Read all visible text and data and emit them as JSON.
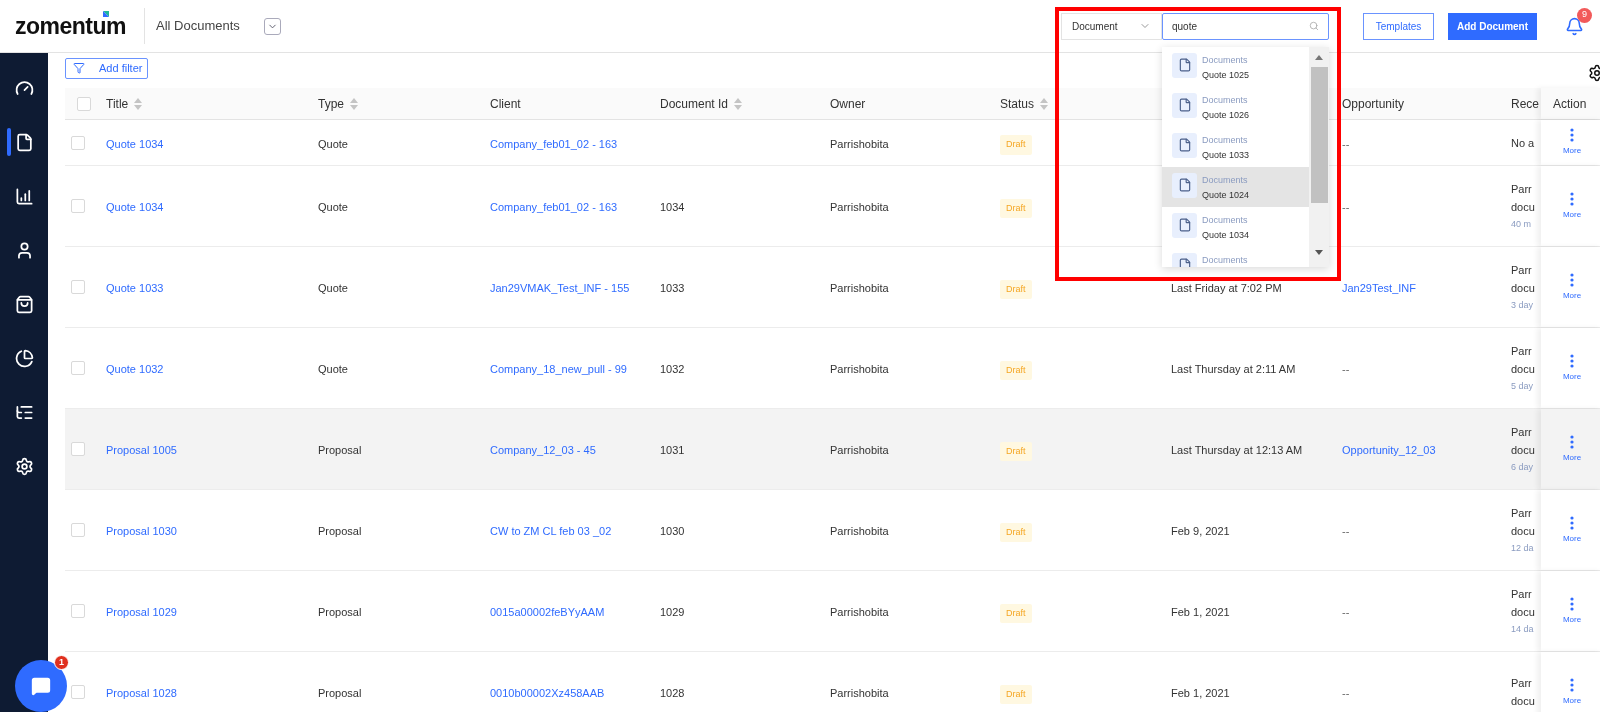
{
  "header": {
    "logo": "zomentum",
    "view": "All Documents",
    "search_scope": "Document",
    "search_value": "quote",
    "buttons": [
      "Templates",
      "Add Document"
    ],
    "notifications_badge": "9"
  },
  "sidebar": {
    "items": [
      {
        "kind": "dashboard",
        "selected": false
      },
      {
        "kind": "documents",
        "selected": true
      },
      {
        "kind": "reports",
        "selected": false
      },
      {
        "kind": "clients",
        "selected": false
      },
      {
        "kind": "products",
        "selected": false
      },
      {
        "kind": "analytics",
        "selected": false
      },
      {
        "kind": "workflows",
        "selected": false
      },
      {
        "kind": "settings",
        "selected": false
      }
    ]
  },
  "filter_button": "Add filter",
  "table": {
    "select_all_checked": false,
    "header": {
      "title": {
        "label": "Title",
        "sortable": true
      },
      "type": {
        "label": "Type",
        "sortable": true
      },
      "client": {
        "label": "Client",
        "sortable": false
      },
      "document_id": {
        "label": "Document Id",
        "sortable": true
      },
      "owner": {
        "label": "Owner",
        "sortable": false
      },
      "status": {
        "label": "Status",
        "sortable": true
      },
      "opportunity": {
        "label": "Opportunity",
        "sortable": false
      },
      "recent": {
        "label": "Rece"
      },
      "action": {
        "label": "Action"
      }
    },
    "rows": [
      {
        "checked": false,
        "highlighted": false,
        "title": "Quote 1034",
        "type": "Quote",
        "client": "Company_feb01_02 - 163",
        "owner": "Parrishobita",
        "status": "Draft",
        "opportunity": {
          "text": "--",
          "link": false
        },
        "recent": [
          "No a"
        ],
        "action": "More"
      },
      {
        "checked": false,
        "highlighted": false,
        "title": "Quote 1034",
        "type": "Quote",
        "client": "Company_feb01_02 - 163",
        "document_id": "1034",
        "owner": "Parrishobita",
        "status": "Draft",
        "opportunity": {
          "text": "--",
          "link": false
        },
        "recent": [
          "Parr",
          "docu",
          "40 m"
        ],
        "action": "More"
      },
      {
        "checked": false,
        "highlighted": false,
        "title": "Quote 1033",
        "type": "Quote",
        "client": "Jan29VMAK_Test_INF - 155",
        "document_id": "1033",
        "owner": "Parrishobita",
        "status": "Draft",
        "date": "Last Friday at 7:02 PM",
        "opportunity": {
          "text": "Jan29Test_INF",
          "link": true
        },
        "recent": [
          "Parr",
          "docu",
          "3 day"
        ],
        "action": "More"
      },
      {
        "checked": false,
        "highlighted": false,
        "title": "Quote 1032",
        "type": "Quote",
        "client": "Company_18_new_pull - 99",
        "document_id": "1032",
        "owner": "Parrishobita",
        "status": "Draft",
        "date": "Last Thursday at 2:11 AM",
        "opportunity": {
          "text": "--",
          "link": false
        },
        "recent": [
          "Parr",
          "docu",
          "5 day"
        ],
        "action": "More"
      },
      {
        "checked": false,
        "highlighted": true,
        "title": "Proposal 1005",
        "type": "Proposal",
        "client": "Company_12_03 - 45",
        "document_id": "1031",
        "owner": "Parrishobita",
        "status": "Draft",
        "date": "Last Thursday at 12:13 AM",
        "opportunity": {
          "text": "Opportunity_12_03",
          "link": true
        },
        "recent": [
          "Parr",
          "docu",
          "6 day"
        ],
        "action": "More"
      },
      {
        "checked": false,
        "highlighted": false,
        "title": "Proposal 1030",
        "type": "Proposal",
        "client": "CW to ZM CL feb 03 _02",
        "document_id": "1030",
        "owner": "Parrishobita",
        "status": "Draft",
        "date": "Feb 9, 2021",
        "opportunity": {
          "text": "--",
          "link": false
        },
        "recent": [
          "Parr",
          "docu",
          "12 da"
        ],
        "action": "More"
      },
      {
        "checked": false,
        "highlighted": false,
        "title": "Proposal 1029",
        "type": "Proposal",
        "client": "0015a00002feBYyAAM",
        "document_id": "1029",
        "owner": "Parrishobita",
        "status": "Draft",
        "date": "Feb 1, 2021",
        "opportunity": {
          "text": "--",
          "link": false
        },
        "recent": [
          "Parr",
          "docu",
          "14 da"
        ],
        "action": "More"
      },
      {
        "checked": false,
        "highlighted": false,
        "title": "Proposal 1028",
        "type": "Proposal",
        "client": "0010b00002Xz458AAB",
        "document_id": "1028",
        "owner": "Parrishobita",
        "status": "Draft",
        "date": "Feb 1, 2021",
        "opportunity": {
          "text": "--",
          "link": false
        },
        "recent": [
          "Parr",
          "docu"
        ],
        "action": "More"
      }
    ]
  },
  "search_results": {
    "items": [
      {
        "category": "Documents",
        "title": "Quote 1025",
        "selected": false
      },
      {
        "category": "Documents",
        "title": "Quote 1026",
        "selected": false
      },
      {
        "category": "Documents",
        "title": "Quote 1033",
        "selected": false
      },
      {
        "category": "Documents",
        "title": "Quote 1024",
        "selected": true
      },
      {
        "category": "Documents",
        "title": "Quote 1034",
        "selected": false
      },
      {
        "category": "Documents",
        "selected": false
      }
    ]
  },
  "chat": {
    "badge": "1"
  }
}
